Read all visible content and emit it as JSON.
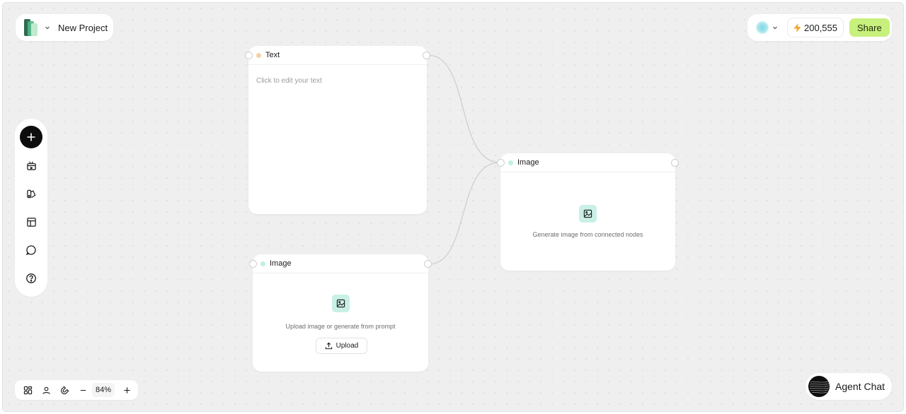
{
  "project": {
    "name": "New Project"
  },
  "header": {
    "credits": "200,555",
    "share_label": "Share"
  },
  "zoom": {
    "level": "84%"
  },
  "agent": {
    "label": "Agent Chat"
  },
  "nodes": {
    "text": {
      "title": "Text",
      "placeholder": "Click to edit your text"
    },
    "image_upload": {
      "title": "Image",
      "caption": "Upload image or generate from prompt",
      "upload_label": "Upload"
    },
    "image_generate": {
      "title": "Image",
      "caption": "Generate image from connected nodes"
    }
  },
  "colors": {
    "share_bg": "#c8f07c",
    "text_dot": "#f7d0a3",
    "image_dot": "#bff0e3",
    "image_icon_bg": "#c9f0e6",
    "add_button": "#0d0d0d"
  }
}
